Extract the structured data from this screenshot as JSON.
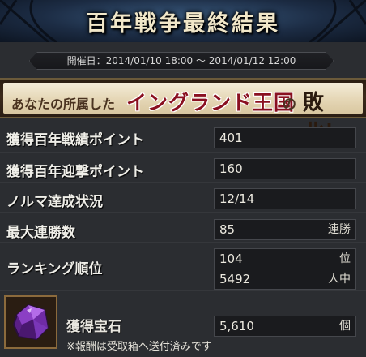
{
  "banner": {
    "title": "百年戦争最終結果"
  },
  "period": {
    "text": "開催日：2014/01/10 18:00 ～ 2014/01/12 12:00"
  },
  "result": {
    "prefix": "あなたの所属した",
    "country": "イングランド王国",
    "particle": "の",
    "verdict": "敗北！"
  },
  "stats": [
    {
      "label": "獲得百年戦績ポイント",
      "value": "401",
      "unit": ""
    },
    {
      "label": "獲得百年迎撃ポイント",
      "value": "160",
      "unit": ""
    },
    {
      "label": "ノルマ達成状況",
      "value": "12/14",
      "unit": ""
    },
    {
      "label": "最大連勝数",
      "value": "85",
      "unit": "連勝"
    }
  ],
  "ranking": {
    "label": "ランキング順位",
    "rank": "104",
    "rank_unit": "位",
    "total": "5492",
    "total_unit": "人中"
  },
  "gems": {
    "label": "獲得宝石",
    "value": "5,610",
    "unit": "個",
    "icon": "purple-gem-icon"
  },
  "note": "※報酬は受取箱へ送付済みです",
  "colors": {
    "country_red": "#8a1020",
    "banner_blue": "#1c2c44",
    "gem_purple": "#8b3fc4"
  }
}
